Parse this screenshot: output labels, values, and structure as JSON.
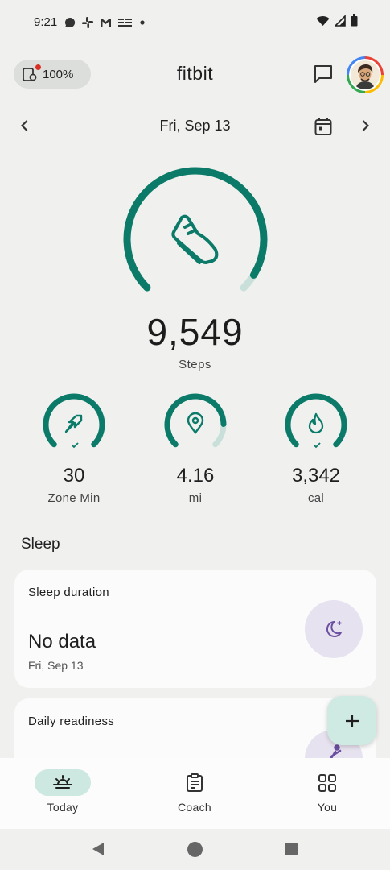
{
  "status_bar": {
    "time": "9:21",
    "left_icons": [
      "chat-bubble-icon",
      "slack-icon",
      "gmail-icon",
      "news-icon",
      "dot-icon"
    ],
    "right_icons": [
      "wifi-icon",
      "cell-signal-icon",
      "battery-icon"
    ]
  },
  "header": {
    "device_battery": "100%",
    "app_title": "fitbit",
    "icons": [
      "device-icon",
      "message-icon",
      "avatar"
    ]
  },
  "date_nav": {
    "date": "Fri, Sep 13",
    "icons": [
      "chevron-left-icon",
      "calendar-icon",
      "chevron-right-icon"
    ]
  },
  "steps": {
    "value": "9,549",
    "label": "Steps",
    "progress": 0.95,
    "icon": "shoe-icon"
  },
  "stats": [
    {
      "value": "30",
      "label": "Zone Min",
      "icon": "zone-arrow-icon",
      "progress": 1.0,
      "goal_met": true
    },
    {
      "value": "4.16",
      "label": "mi",
      "icon": "location-pin-icon",
      "progress": 0.83,
      "goal_met": false
    },
    {
      "value": "3,342",
      "label": "cal",
      "icon": "flame-icon",
      "progress": 1.0,
      "goal_met": true
    }
  ],
  "sleep_section": {
    "title": "Sleep",
    "card": {
      "title": "Sleep duration",
      "value": "No data",
      "date": "Fri, Sep 13",
      "icon": "moon-icon"
    }
  },
  "readiness_card": {
    "title": "Daily readiness",
    "icon": "readiness-figure-icon"
  },
  "fab": {
    "icon": "plus-icon"
  },
  "bottom_nav": {
    "items": [
      {
        "label": "Today",
        "icon": "sunrise-icon",
        "active": true
      },
      {
        "label": "Coach",
        "icon": "clipboard-icon",
        "active": false
      },
      {
        "label": "You",
        "icon": "grid-icon",
        "active": false
      }
    ]
  },
  "system_nav": [
    "back-icon",
    "home-icon",
    "recents-icon"
  ],
  "colors": {
    "accent": "#0b7a68",
    "ring_track": "#c9e0da",
    "background": "#f0f1ef",
    "card": "#fafbfa",
    "sleep_icon_bg": "#e7e2ef",
    "sleep_icon": "#6b4fa0",
    "nav_active": "#cde8e1",
    "fab_bg": "#cfe9e3"
  }
}
